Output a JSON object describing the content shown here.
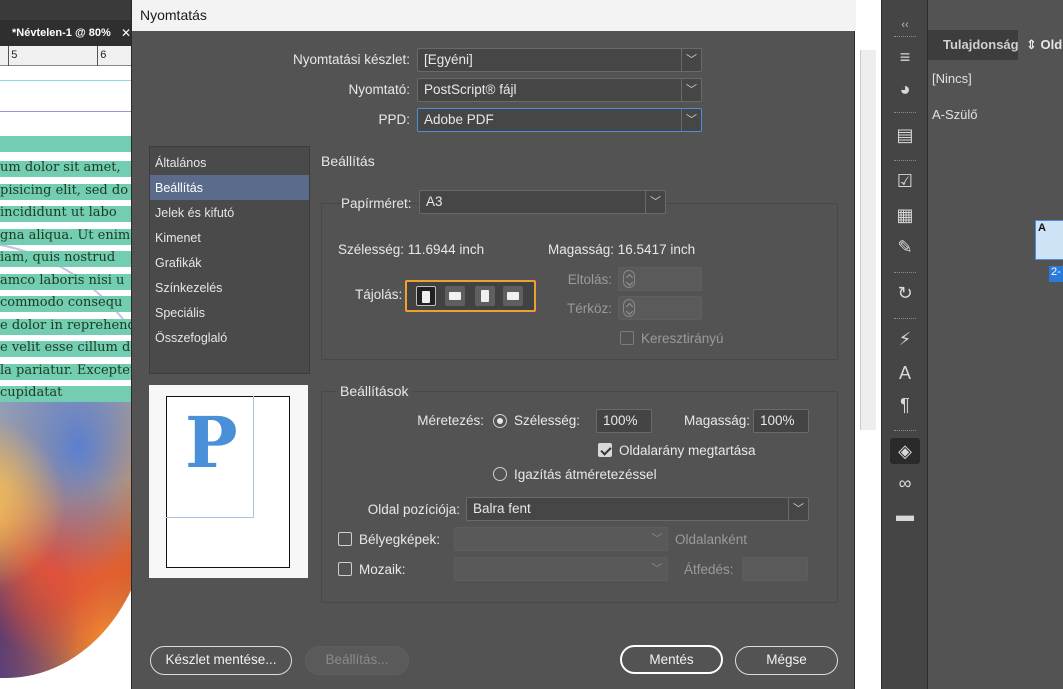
{
  "document": {
    "tab_title": "*Névtelen-1 @ 80%",
    "tab_close": "✕",
    "ruler_labels": [
      "5",
      "6"
    ],
    "text_lines": [
      "um dolor sit amet,",
      "pisicing elit, sed do e",
      " incididunt ut labo",
      "gna aliqua. Ut enim",
      "iam, quis nostrud",
      "amco laboris nisi u",
      " commodo consequ",
      "e dolor in reprehend",
      "e velit esse cillum do",
      "la pariatur. Excepteu",
      " cupidatat"
    ]
  },
  "dialog": {
    "title": "Nyomtatás",
    "preset_label": "Nyomtatási készlet:",
    "preset_value": "[Egyéni]",
    "printer_label": "Nyomtató:",
    "printer_value": "PostScript® fájl",
    "ppd_label": "PPD:",
    "ppd_value": "Adobe PDF",
    "sidebar": [
      {
        "label": "Általános",
        "selected": false
      },
      {
        "label": "Beállítás",
        "selected": true
      },
      {
        "label": "Jelek és kifutó",
        "selected": false
      },
      {
        "label": "Kimenet",
        "selected": false
      },
      {
        "label": "Grafikák",
        "selected": false
      },
      {
        "label": "Színkezelés",
        "selected": false
      },
      {
        "label": "Speciális",
        "selected": false
      },
      {
        "label": "Összefoglaló",
        "selected": false
      }
    ],
    "preview_letter": "P",
    "setup": {
      "section_title": "Beállítás",
      "paper_size_label": "Papírméret:",
      "paper_size_value": "A3",
      "width_text": "Szélesség: 11.6944 inch",
      "height_text": "Magasság: 16.5417 inch",
      "orientation_label": "Tájolás:",
      "offset_label": "Eltolás:",
      "gap_label": "Térköz:",
      "transverse_label": "Keresztirányú"
    },
    "options": {
      "section_title": "Beállítások",
      "scaling_label": "Méretezés:",
      "width_label": "Szélesség:",
      "width_value": "100%",
      "height_label": "Magasság:",
      "height_value": "100%",
      "constrain_label": "Oldalarány megtartása",
      "fit_label": "Igazítás átméretezéssel",
      "page_position_label": "Oldal pozíciója:",
      "page_position_value": "Balra fent",
      "thumbnails_label": "Bélyegképek:",
      "per_page_label": "Oldalanként",
      "tile_label": "Mozaik:",
      "overlap_label": "Átfedés:"
    },
    "buttons": {
      "save_preset": "Készlet mentése...",
      "setup": "Beállítás...",
      "save": "Mentés",
      "cancel": "Mégse"
    }
  },
  "right_panel": {
    "collapse": "‹‹",
    "tab_properties": "Tulajdonság",
    "tab_pages": "⇕ Old",
    "row_none": "[Nincs]",
    "row_master": "A-Szülő",
    "thumb_letter": "A",
    "page_badge": "2-"
  }
}
